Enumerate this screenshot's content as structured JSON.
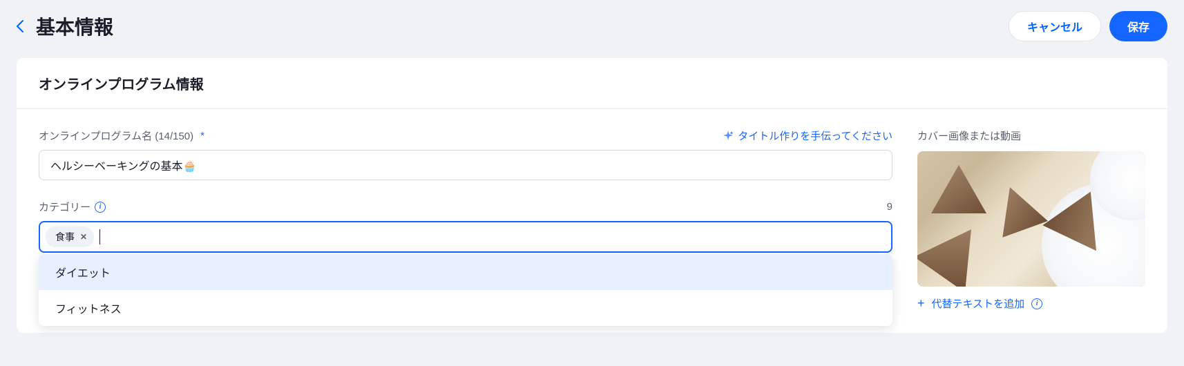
{
  "header": {
    "title": "基本情報",
    "cancel_label": "キャンセル",
    "save_label": "保存"
  },
  "panel": {
    "heading": "オンラインプログラム情報"
  },
  "name_field": {
    "label": "オンラインプログラム名 (14/150)",
    "helper_text": "タイトル作りを手伝ってください",
    "value": "ヘルシーベーキングの基本🧁"
  },
  "category_field": {
    "label": "カテゴリー",
    "limit": "9",
    "tags": [
      {
        "label": "食事"
      }
    ],
    "options": [
      {
        "label": "ダイエット",
        "highlighted": true
      },
      {
        "label": "フィットネス",
        "highlighted": false
      }
    ]
  },
  "cover": {
    "label": "カバー画像または動画",
    "alt_text_link": "代替テキストを追加"
  }
}
